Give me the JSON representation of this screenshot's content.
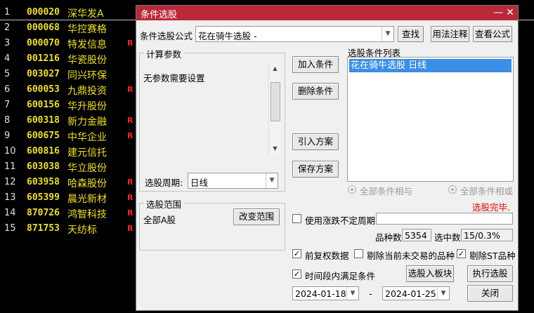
{
  "stock_list": [
    {
      "num": "1",
      "code": "000020",
      "name": "深华发A",
      "badge": ""
    },
    {
      "num": "2",
      "code": "000068",
      "name": "华控赛格",
      "badge": ""
    },
    {
      "num": "3",
      "code": "000070",
      "name": "特发信息",
      "badge": "R"
    },
    {
      "num": "4",
      "code": "001216",
      "name": "华瓷股份",
      "badge": ""
    },
    {
      "num": "5",
      "code": "003027",
      "name": "同兴环保",
      "badge": ""
    },
    {
      "num": "6",
      "code": "600053",
      "name": "九鼎投资",
      "badge": "R"
    },
    {
      "num": "7",
      "code": "600156",
      "name": "华升股份",
      "badge": ""
    },
    {
      "num": "8",
      "code": "600318",
      "name": "新力金融",
      "badge": "R"
    },
    {
      "num": "9",
      "code": "600675",
      "name": "中华企业",
      "badge": "R"
    },
    {
      "num": "10",
      "code": "600816",
      "name": "建元信托",
      "badge": ""
    },
    {
      "num": "11",
      "code": "603038",
      "name": "华立股份",
      "badge": ""
    },
    {
      "num": "12",
      "code": "603958",
      "name": "哈森股份",
      "badge": "R"
    },
    {
      "num": "13",
      "code": "605399",
      "name": "晨光新材",
      "badge": "R"
    },
    {
      "num": "14",
      "code": "870726",
      "name": "鸿智科技",
      "badge": "R"
    },
    {
      "num": "15",
      "code": "871753",
      "name": "天纺标",
      "badge": "R"
    }
  ],
  "dialog": {
    "title": "条件选股",
    "formula_label": "条件选股公式",
    "formula_value": "花在骑牛选股 -",
    "find_button": "查找",
    "usage_button": "用法注释",
    "view_formula_button": "查看公式",
    "params_group": "计算参数",
    "params_text": "无参数需要设置",
    "period_label": "选股周期:",
    "period_value": "日线",
    "add_condition": "加入条件",
    "delete_condition": "删除条件",
    "import_plan": "引入方案",
    "save_plan": "保存方案",
    "condition_list_label": "选股条件列表",
    "condition_items": [
      "花在骑牛选股  日线"
    ],
    "radio_and": "全部条件相与",
    "radio_or": "全部条件相或",
    "status": "选股完毕.",
    "range_group": "选股范围",
    "range_value": "全部A股",
    "change_range": "改变范围",
    "use_irregular_period": "使用涨跌不定周期",
    "count_label": "品种数",
    "count_value": "5354",
    "selected_label": "选中数",
    "selected_value": "15/0.3%",
    "pre_adjust": "前复权数据",
    "exclude_untraded": "剔除当前未交易的品种",
    "exclude_st": "剔除ST品种",
    "period_satisfy": "时间段内满足条件",
    "select_to_board": "选股入板块",
    "execute": "执行选股",
    "start_date": "2024-01-18",
    "date_sep": "-",
    "end_date": "2024-01-25",
    "close": "关闭",
    "colors": {
      "titlebar": "#b9293a",
      "selection": "#3a8ee6",
      "status": "#e00000"
    }
  }
}
